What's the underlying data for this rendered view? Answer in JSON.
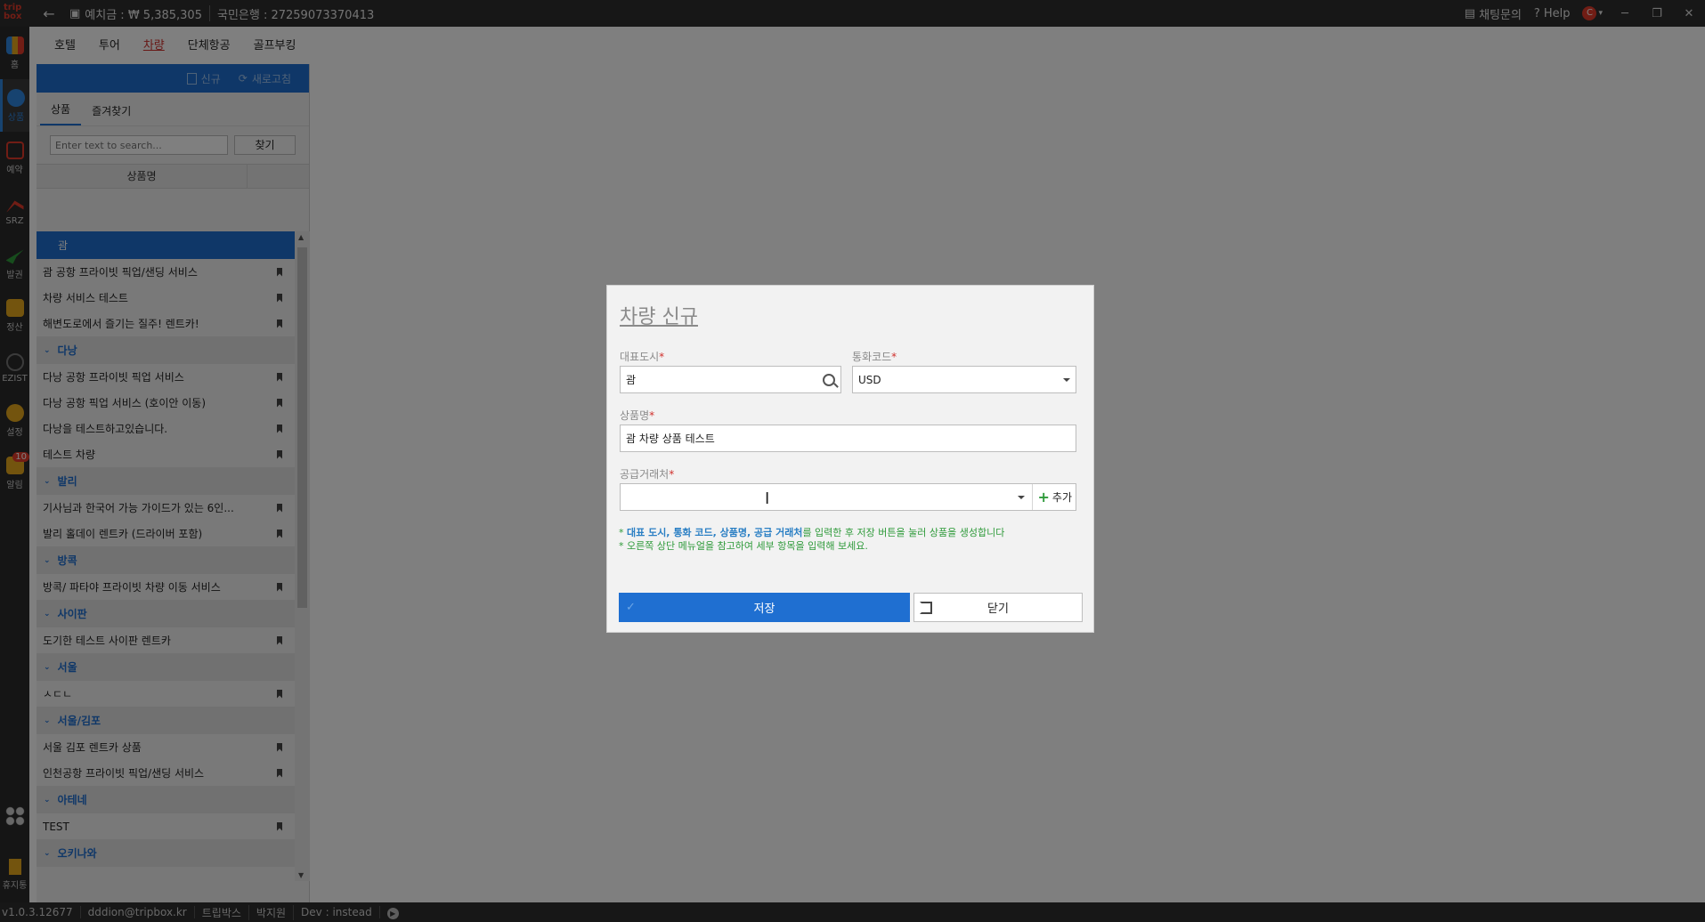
{
  "titlebar": {
    "logo": "trip box",
    "deposit": "예치금 : ₩ 5,385,305",
    "bank": "국민은행 : 27259073370413",
    "chat": "채팅문의",
    "help": "Help",
    "window_min": "─",
    "window_restore": "❐",
    "window_close": "✕"
  },
  "rail": {
    "items": [
      {
        "label": "홈",
        "icon": "home-chart-icon",
        "color": "#e23b2a"
      },
      {
        "label": "상품",
        "icon": "globe-icon",
        "color": "#2f86e0",
        "active": true
      },
      {
        "label": "예약",
        "icon": "booking-icon",
        "color": "#e23b2a"
      },
      {
        "label": "SRZ",
        "icon": "srz-icon",
        "color": "#e23b2a"
      },
      {
        "label": "발권",
        "icon": "plane-icon",
        "color": "#2e9a3a"
      },
      {
        "label": "정산",
        "icon": "wallet-icon",
        "color": "#e6a91c"
      },
      {
        "label": "EZIST",
        "icon": "ezist-icon",
        "color": "#777777"
      },
      {
        "label": "설정",
        "icon": "gear-icon",
        "color": "#e6a91c"
      },
      {
        "label": "알림",
        "icon": "chat-bell-icon",
        "color": "#e6a91c",
        "badge": "10"
      }
    ],
    "trash_label": "휴지통"
  },
  "top_tabs": [
    {
      "label": "호텔"
    },
    {
      "label": "투어"
    },
    {
      "label": "차량",
      "active": true
    },
    {
      "label": "단체항공"
    },
    {
      "label": "골프부킹"
    }
  ],
  "panel": {
    "toolbar_new": "신규",
    "toolbar_refresh": "새로고침",
    "tabs": [
      {
        "label": "상품",
        "active": true
      },
      {
        "label": "즐겨찾기"
      }
    ],
    "search_placeholder": "Enter text to search...",
    "search_button": "찾기",
    "column_header": "상품명",
    "rows": [
      {
        "type": "group",
        "label": "괌",
        "selected": true
      },
      {
        "type": "item",
        "label": "괌 공항 프라이빗 픽업/샌딩 서비스"
      },
      {
        "type": "item",
        "label": "차량 서비스 테스트"
      },
      {
        "type": "item",
        "label": "해변도로에서 즐기는 질주! 렌트카!"
      },
      {
        "type": "group",
        "label": "다낭"
      },
      {
        "type": "item",
        "label": "다낭 공항 프라이빗 픽업 서비스"
      },
      {
        "type": "item",
        "label": "다낭 공항 픽업 서비스 (호이안 이동)"
      },
      {
        "type": "item",
        "label": "다낭을 테스트하고있습니다."
      },
      {
        "type": "item",
        "label": "테스트 차량"
      },
      {
        "type": "group",
        "label": "발리"
      },
      {
        "type": "item",
        "label": "기사님과 한국어 가능 가이드가 있는 6인..."
      },
      {
        "type": "item",
        "label": "발리 홀데이 렌트카 (드라이버 포함)"
      },
      {
        "type": "group",
        "label": "방콕"
      },
      {
        "type": "item",
        "label": "방콕/ 파타야 프라이빗 차량 이동 서비스"
      },
      {
        "type": "group",
        "label": "사이판"
      },
      {
        "type": "item",
        "label": "도기한 테스트 사이판 렌트카"
      },
      {
        "type": "group",
        "label": "서울"
      },
      {
        "type": "item",
        "label": "ㅅㄷㄴ"
      },
      {
        "type": "group",
        "label": "서울/김포"
      },
      {
        "type": "item",
        "label": "서울 김포 렌트카 상품"
      },
      {
        "type": "item",
        "label": "인천공항 프라이빗 픽업/샌딩 서비스"
      },
      {
        "type": "group",
        "label": "아테네"
      },
      {
        "type": "item",
        "label": "TEST"
      },
      {
        "type": "group",
        "label": "오키나와"
      }
    ]
  },
  "statusbar": {
    "version": "v1.0.3.12677",
    "email": "dddion@tripbox.kr",
    "company": "트립박스",
    "user": "박지원",
    "env": "Dev : instead"
  },
  "dialog": {
    "title": "차량 신규",
    "city_label": "대표도시",
    "city_value": "괌",
    "currency_label": "통화코드",
    "currency_value": "USD",
    "name_label": "상품명",
    "name_value": "괌 차량 상품 테스트",
    "supplier_label": "공급거래처",
    "supplier_value": "",
    "add_label": "추가",
    "hint1_prefix": "* ",
    "hint1_bold": "대표 도시, 통화 코드, 상품명, 공급 거래처",
    "hint1_rest": "를 입력한 후 저장 버튼을 눌러 상품을 생성합니다",
    "hint2": "* 오른쪽 상단 메뉴얼을 참고하여 세부 항목을 입력해 보세요.",
    "save_label": "저장",
    "close_label": "닫기",
    "required_mark": "*"
  },
  "colors": {
    "accent": "#1f6fd1",
    "required": "#d0312d",
    "hint": "#2e9a3a",
    "overlay": "rgba(0,0,0,0.5)"
  }
}
